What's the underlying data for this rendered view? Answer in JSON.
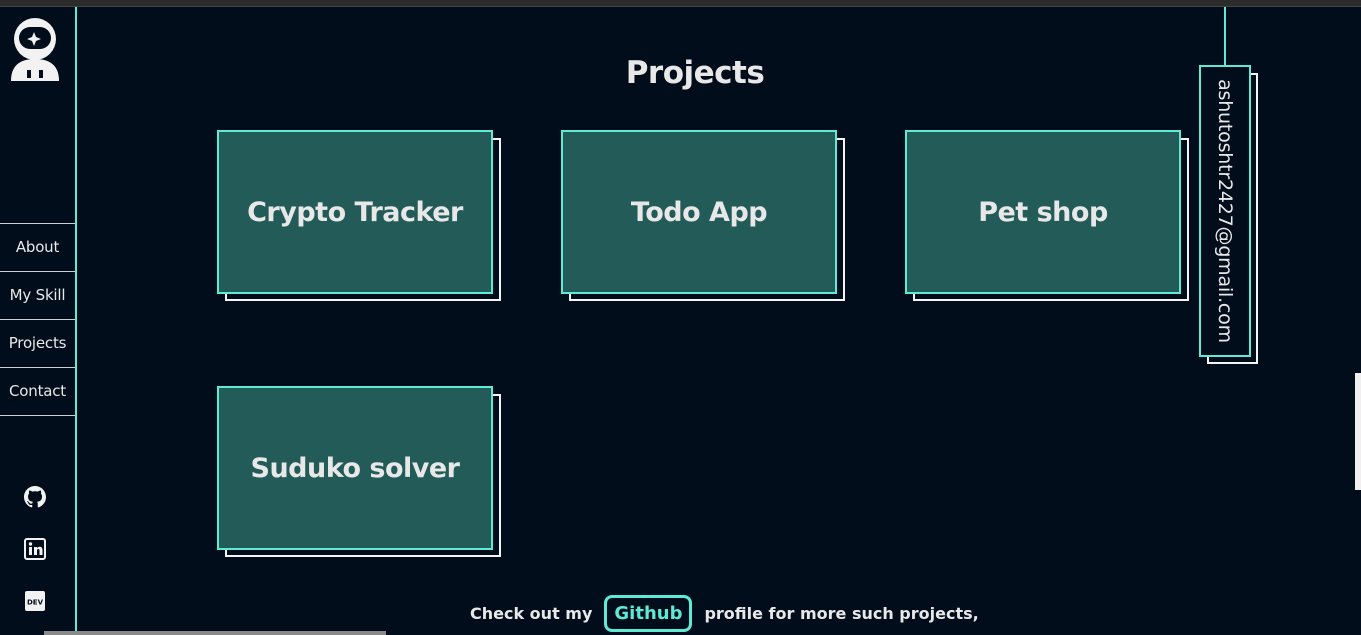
{
  "nav": {
    "items": [
      {
        "label": "About"
      },
      {
        "label": "My Skill"
      },
      {
        "label": "Projects"
      },
      {
        "label": "Contact"
      }
    ]
  },
  "social": {
    "icons": [
      "github-icon",
      "linkedin-icon",
      "dev-icon"
    ],
    "dev_label": "DEV"
  },
  "main": {
    "title": "Projects",
    "projects": [
      {
        "name": "Crypto Tracker"
      },
      {
        "name": "Todo App"
      },
      {
        "name": "Pet shop"
      },
      {
        "name": "Suduko solver"
      }
    ]
  },
  "email": {
    "address": "ashutoshtr2427@gmail.com"
  },
  "footer": {
    "prefix": "Check out my",
    "link": "Github",
    "suffix": "profile for more such projects,"
  },
  "colors": {
    "background": "#010d1a",
    "accent": "#5eead4",
    "card": "#235b59"
  }
}
